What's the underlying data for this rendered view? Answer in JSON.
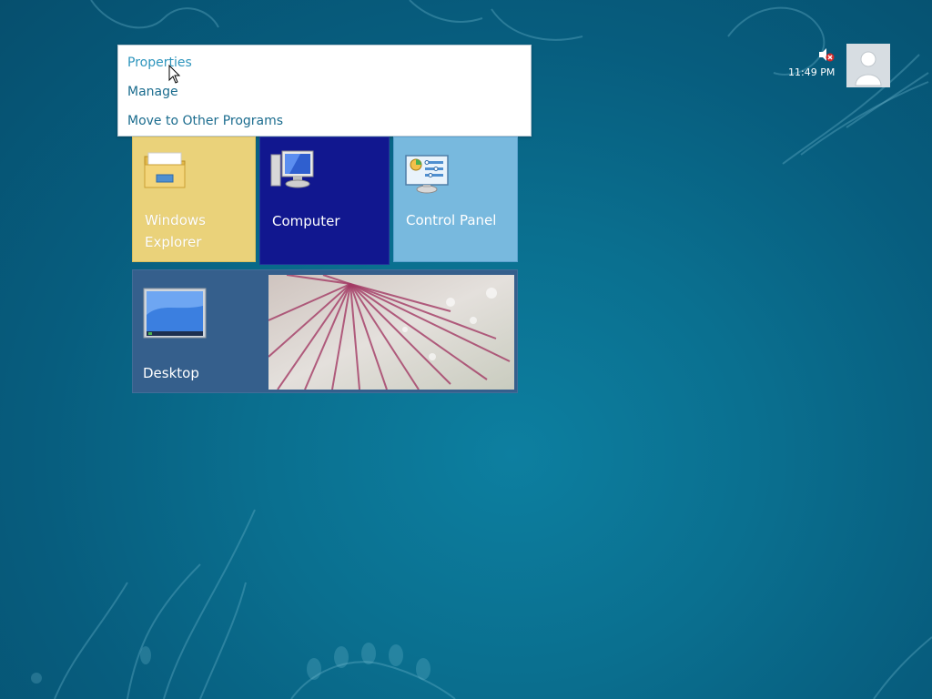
{
  "context_menu": {
    "items": [
      {
        "label": "Properties"
      },
      {
        "label": "Manage"
      },
      {
        "label": "Move to Other Programs"
      }
    ]
  },
  "tiles": {
    "windows_explorer": {
      "label_line1": "Windows",
      "label_line2": "Explorer",
      "icon": "folder-icon",
      "color": "#ead27a"
    },
    "computer": {
      "label": "Computer",
      "icon": "computer-icon",
      "color": "#11178f"
    },
    "control_panel": {
      "label": "Control Panel",
      "icon": "control-panel-icon",
      "color": "#78b9de"
    },
    "desktop": {
      "label": "Desktop",
      "icon": "desktop-monitor-icon",
      "color": "#355f8c"
    }
  },
  "tray": {
    "time": "11:49 PM",
    "volume_icon": "volume-muted-icon",
    "user_icon": "user-avatar-icon"
  },
  "colors": {
    "background": "#0a6f8f",
    "menu_text": "#1b6c8e"
  }
}
